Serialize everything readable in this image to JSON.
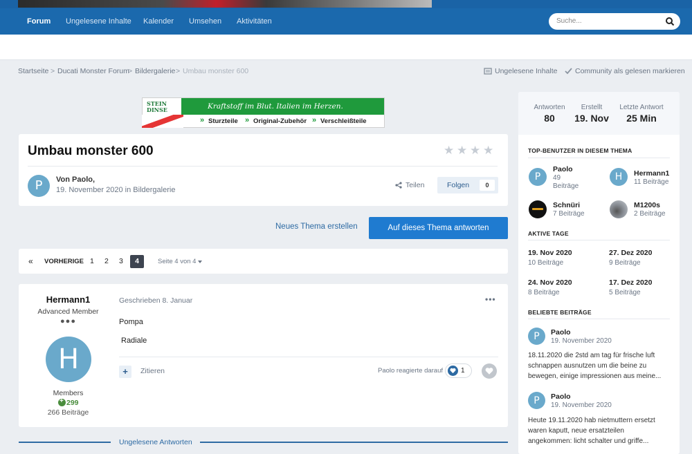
{
  "nav": {
    "items": [
      "Forum",
      "Ungelesene Inhalte",
      "Kalender",
      "Umsehen",
      "Aktivitäten"
    ],
    "search_placeholder": "Suche..."
  },
  "breadcrumb": {
    "items": [
      "Startseite",
      "Ducati Monster Forum",
      "Bildergalerie",
      "Umbau monster 600"
    ],
    "separator": ">",
    "unread_label": "Ungelesene Inhalte",
    "mark_read_label": "Community als gelesen markieren"
  },
  "ad": {
    "slogan": "Kraftstoff im Blut. Italien im Herzen.",
    "links": [
      "Sturzteile",
      "Original-Zubehör",
      "Verschleißteile"
    ],
    "logo_text": "STEIN DINSE"
  },
  "thread": {
    "title": "Umbau monster 600",
    "rating": 0,
    "author_initial": "P",
    "by_label": "Von Paolo,",
    "date_in": "19. November 2020 in Bildergalerie",
    "share_label": "Teilen",
    "follow_label": "Folgen",
    "follow_count": "0"
  },
  "actions": {
    "new_thread": "Neues Thema erstellen",
    "reply": "Auf dieses Thema antworten"
  },
  "pagination": {
    "first": "«",
    "prev": "VORHERIGE",
    "pages": [
      "1",
      "2",
      "3"
    ],
    "current": "4",
    "page_of": "Seite 4 von 4"
  },
  "post": {
    "author": "Hermann1",
    "rank": "Advanced Member",
    "rank_dots": "●●●",
    "avatar_initial": "H",
    "group": "Members",
    "reputation": "299",
    "posts": "266 Beiträge",
    "date": "Geschrieben 8. Januar",
    "menu": "•••",
    "lines": [
      "Pompa",
      "Radiale"
    ],
    "quote_label": "Zitieren",
    "reacted_label": "Paolo reagierte darauf",
    "reaction_count": "1"
  },
  "unread_replies": "Ungelesene Antworten",
  "sidebar": {
    "stats": [
      {
        "label": "Antworten",
        "value": "80"
      },
      {
        "label": "Erstellt",
        "value": "19. Nov"
      },
      {
        "label": "Letzte Antwort",
        "value": "25 Min"
      }
    ],
    "top_users_title": "TOP-BENUTZER IN DIESEM THEMA",
    "top_users": [
      {
        "name": "Paolo",
        "count": "49",
        "unit": "Beiträge",
        "initial": "P"
      },
      {
        "name": "Hermann1",
        "count": "11 Beiträge",
        "initial": "H"
      },
      {
        "name": "Schnüri",
        "count": "7 Beiträge"
      },
      {
        "name": "M1200s",
        "count": "2 Beiträge"
      }
    ],
    "active_days_title": "AKTIVE TAGE",
    "active_days": [
      {
        "date": "19. Nov 2020",
        "count": "10 Beiträge"
      },
      {
        "date": "27. Dez 2020",
        "count": "9 Beiträge"
      },
      {
        "date": "24. Nov 2020",
        "count": "8 Beiträge"
      },
      {
        "date": "17. Dez 2020",
        "count": "5 Beiträge"
      }
    ],
    "popular_title": "BELIEBTE BEITRÄGE",
    "popular": [
      {
        "author": "Paolo",
        "initial": "P",
        "date": "19. November 2020",
        "lines": [
          "18.11.2020 die 2std am tag für frische luft",
          "schnappen ausnutzen um die beine zu",
          "bewegen, einige impressionen aus meine..."
        ]
      },
      {
        "author": "Paolo",
        "initial": "P",
        "date": "19. November 2020",
        "lines": [
          "Heute 19.11.2020 hab nietmuttern ersetzt",
          "waren kaputt,  neue ersatzteilen",
          "angekommen: licht schalter und griffe..."
        ]
      }
    ]
  },
  "colors": {
    "nav": "#1b69ad",
    "accent": "#1f7bd0",
    "avatar": "#6aa9cb"
  }
}
